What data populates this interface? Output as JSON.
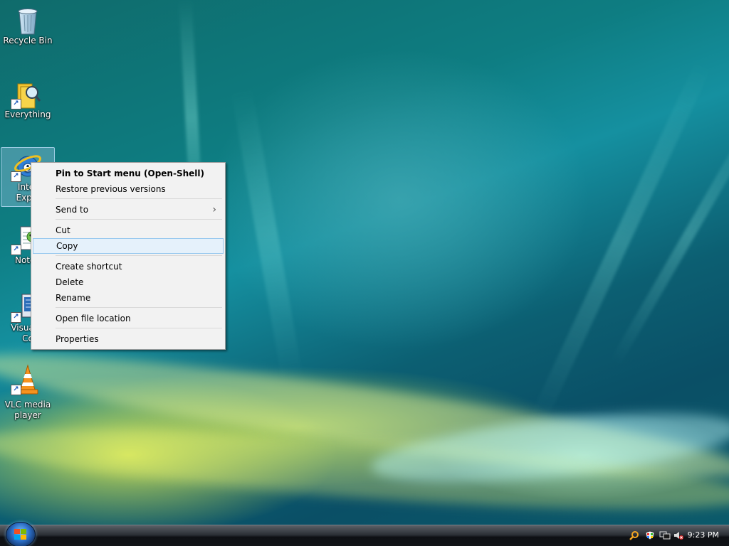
{
  "desktop": {
    "icons": [
      {
        "name": "recycle-bin",
        "label": "Recycle Bin"
      },
      {
        "name": "everything",
        "label": "Everything"
      },
      {
        "name": "internet-explorer",
        "label_line1": "Inter",
        "label_line2": "Explo"
      },
      {
        "name": "notepad",
        "label": "Notep"
      },
      {
        "name": "visual-studio-code",
        "label_line1": "Visual S",
        "label_line2": "Co"
      },
      {
        "name": "vlc-media-player",
        "label": "VLC media player"
      }
    ]
  },
  "context_menu": {
    "items": [
      {
        "label": "Pin to Start menu (Open-Shell)",
        "bold": true
      },
      {
        "label": "Restore previous versions"
      },
      {
        "label": "Send to",
        "submenu": true
      },
      {
        "label": "Cut"
      },
      {
        "label": "Copy",
        "hover": true
      },
      {
        "label": "Create shortcut"
      },
      {
        "label": "Delete"
      },
      {
        "label": "Rename"
      },
      {
        "label": "Open file location"
      },
      {
        "label": "Properties"
      }
    ],
    "submenu_arrow": "›"
  },
  "taskbar": {
    "clock": "9:23 PM",
    "tray_icons": [
      "search-icon",
      "shield-icon",
      "network-icon",
      "volume-muted-icon"
    ]
  }
}
